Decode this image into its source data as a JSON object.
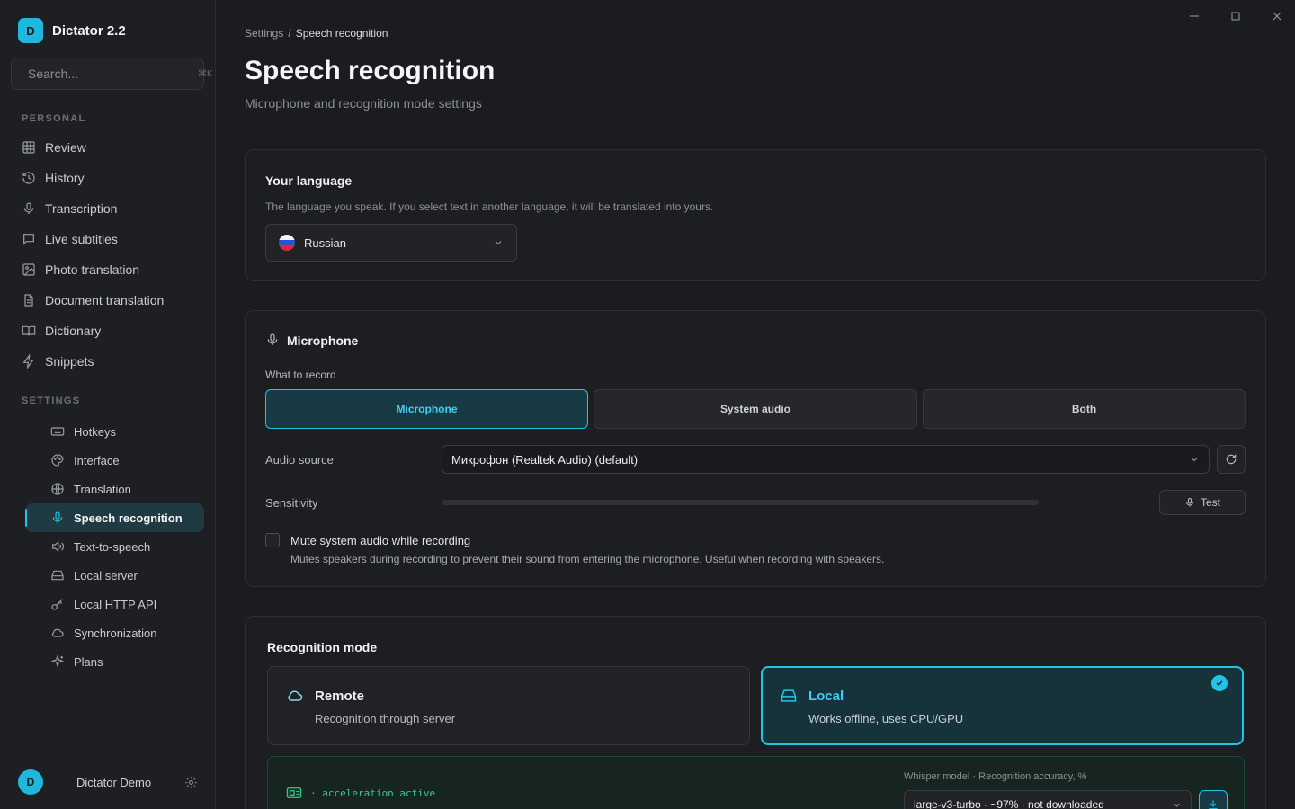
{
  "app": {
    "logo_letter": "D",
    "name": "Dictator 2.2"
  },
  "search": {
    "placeholder": "Search...",
    "shortcut": "⌘K"
  },
  "sidebar": {
    "personal_label": "PERSONAL",
    "personal_items": [
      {
        "label": "Review",
        "icon": "grid-icon"
      },
      {
        "label": "History",
        "icon": "history-icon"
      },
      {
        "label": "Transcription",
        "icon": "mic-icon"
      },
      {
        "label": "Live subtitles",
        "icon": "chat-icon"
      },
      {
        "label": "Photo translation",
        "icon": "image-icon"
      },
      {
        "label": "Document translation",
        "icon": "document-icon"
      },
      {
        "label": "Dictionary",
        "icon": "book-icon"
      },
      {
        "label": "Snippets",
        "icon": "bolt-icon"
      }
    ],
    "settings_label": "SETTINGS",
    "settings_items": [
      {
        "label": "Hotkeys",
        "icon": "keyboard-icon"
      },
      {
        "label": "Interface",
        "icon": "palette-icon"
      },
      {
        "label": "Translation",
        "icon": "globe-icon"
      },
      {
        "label": "Speech recognition",
        "icon": "mic-icon",
        "active": true
      },
      {
        "label": "Text-to-speech",
        "icon": "speaker-icon"
      },
      {
        "label": "Local server",
        "icon": "server-icon"
      },
      {
        "label": "Local HTTP API",
        "icon": "key-icon"
      },
      {
        "label": "Synchronization",
        "icon": "cloud-icon"
      },
      {
        "label": "Plans",
        "icon": "sparkle-icon"
      }
    ]
  },
  "user": {
    "initial": "D",
    "name": "Dictator Demo"
  },
  "breadcrumb": {
    "root": "Settings",
    "separator": "/",
    "current": "Speech recognition"
  },
  "page": {
    "title": "Speech recognition",
    "subtitle": "Microphone and recognition mode settings"
  },
  "language": {
    "title": "Your language",
    "description": "The language you speak. If you select text in another language, it will be translated into yours.",
    "selected": "Russian"
  },
  "microphone": {
    "title": "Microphone",
    "what_to_record_label": "What to record",
    "options": [
      "Microphone",
      "System audio",
      "Both"
    ],
    "selected_option": "Microphone",
    "audio_source_label": "Audio source",
    "audio_source_value": "Микрофон (Realtek Audio) (default)",
    "sensitivity_label": "Sensitivity",
    "sensitivity_level": 0,
    "test_label": "Test",
    "mute_label": "Mute system audio while recording",
    "mute_description": "Mutes speakers during recording to prevent their sound from entering the microphone. Useful when recording with speakers.",
    "mute_checked": false
  },
  "recognition": {
    "title": "Recognition mode",
    "modes": [
      {
        "title": "Remote",
        "description": "Recognition through server",
        "icon": "cloud-icon",
        "selected": false
      },
      {
        "title": "Local",
        "description": "Works offline, uses CPU/GPU",
        "icon": "drive-icon",
        "selected": true
      }
    ],
    "acceleration_text": "· acceleration active",
    "whisper_label": "Whisper model · Recognition accuracy, %",
    "whisper_value": "large-v3-turbo · ~97% · not downloaded"
  },
  "colors": {
    "accent": "#22c3e6",
    "background": "#1b1c1f",
    "card": "#1d1e21",
    "success": "#35c98a"
  }
}
